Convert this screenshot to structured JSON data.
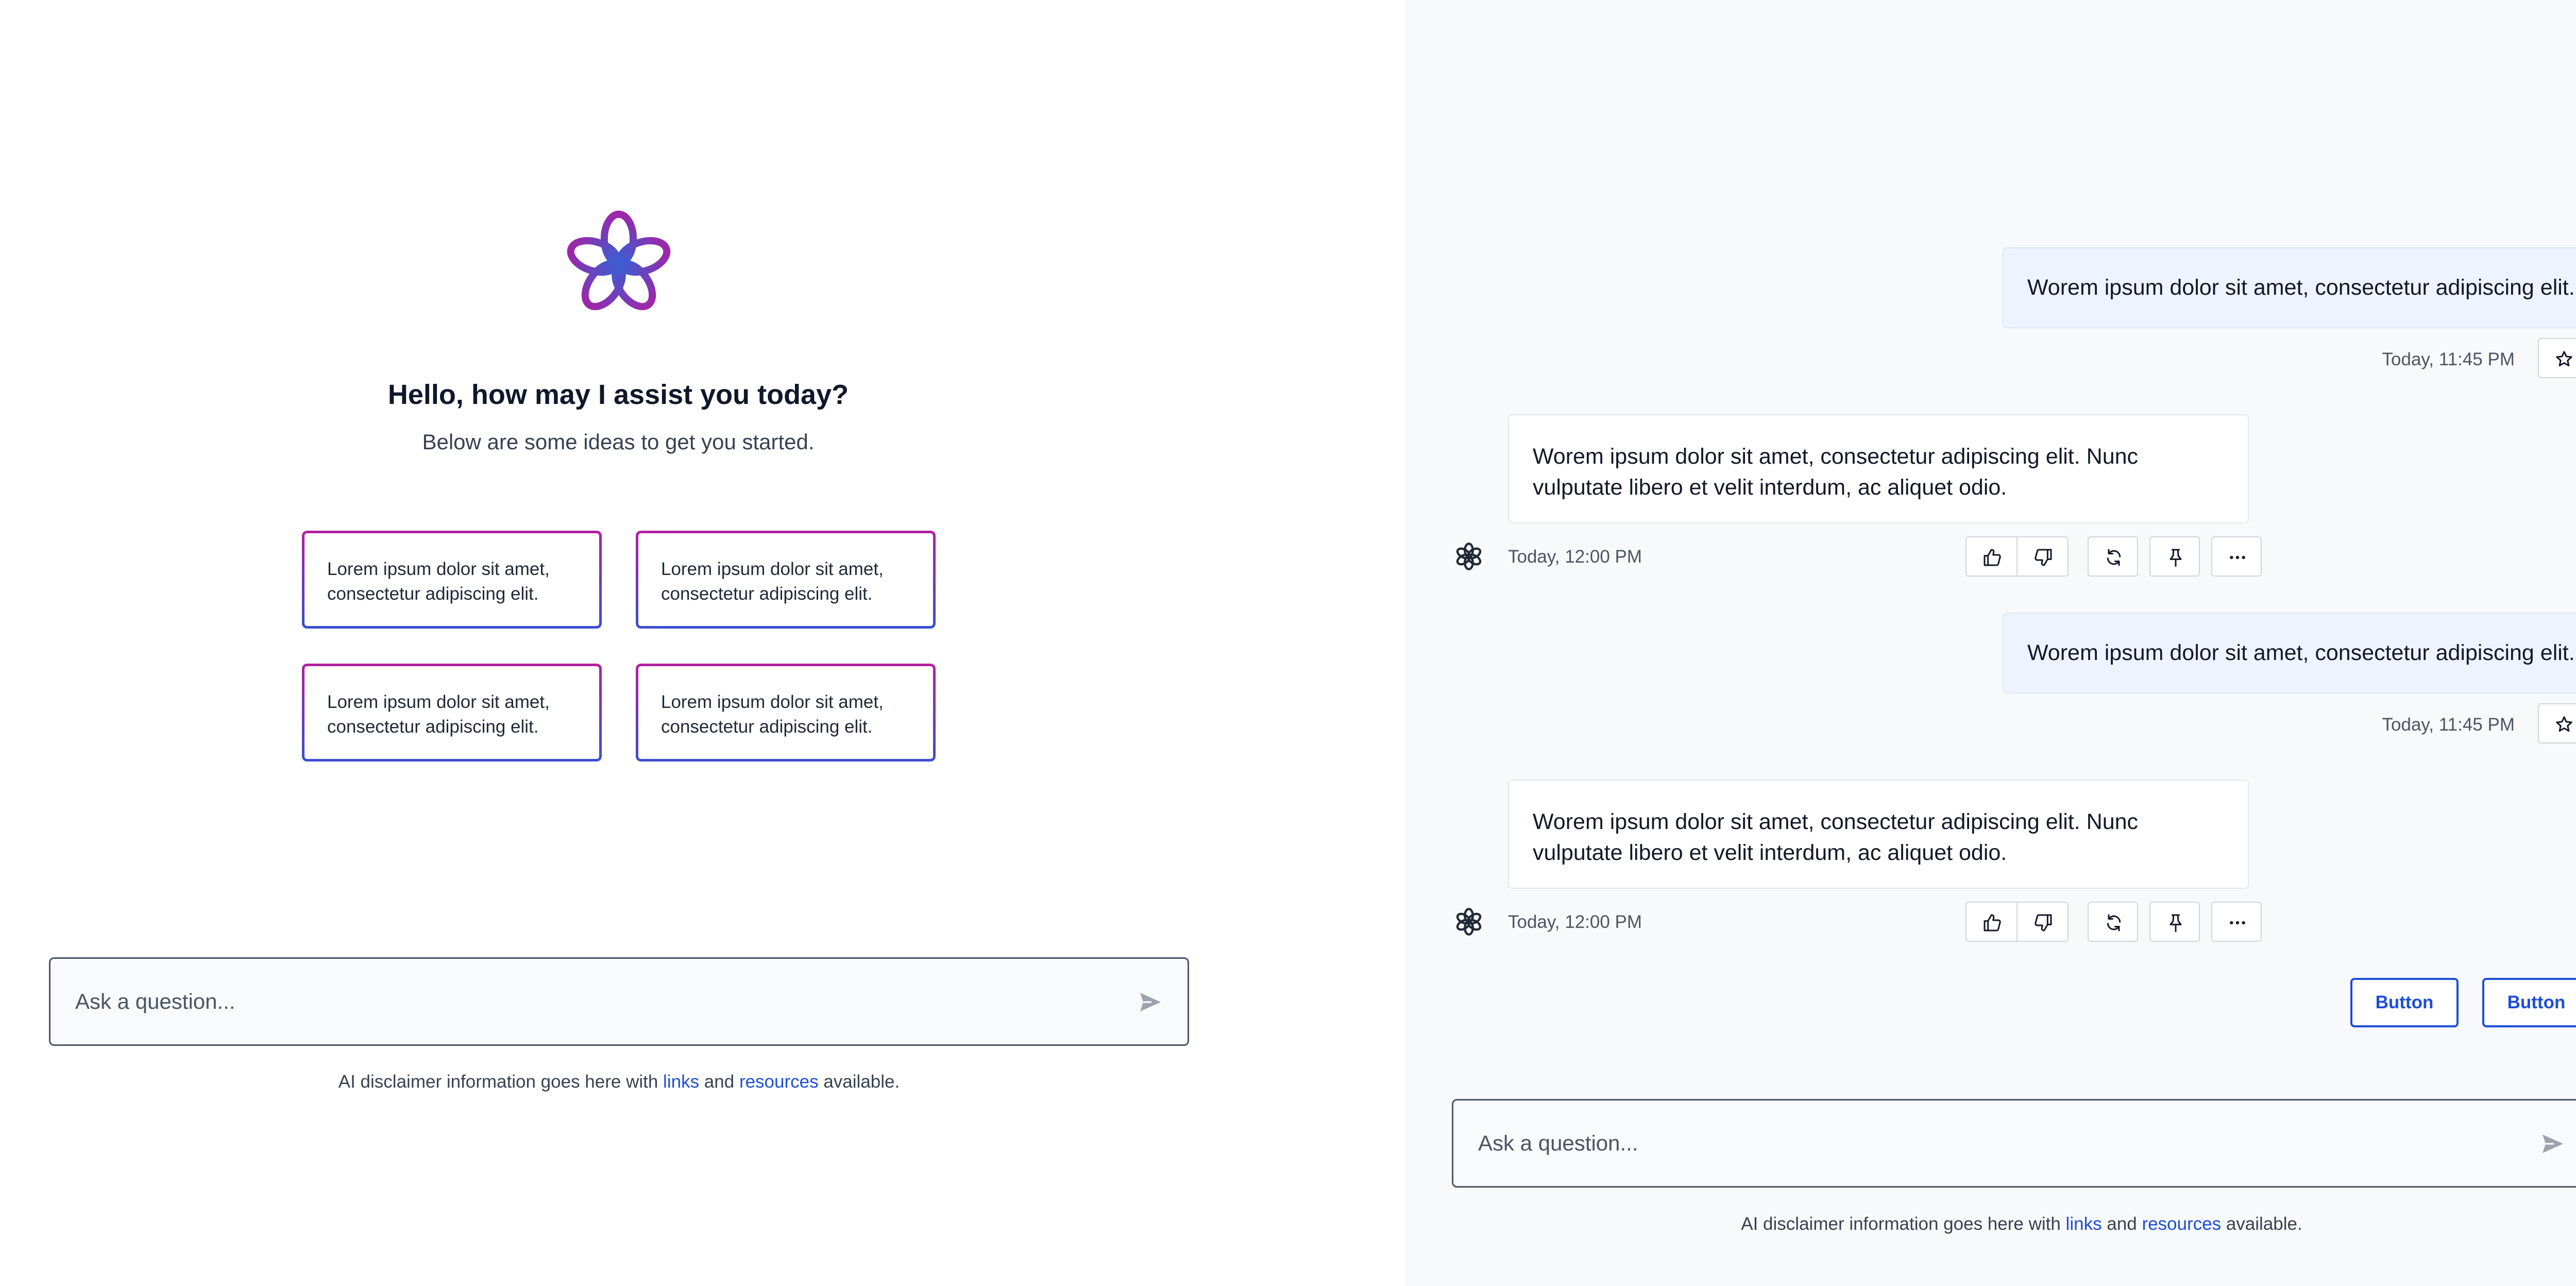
{
  "welcome": {
    "greeting": "Hello, how may I assist you today?",
    "subtitle": "Below are some ideas to get you started.",
    "ideas": [
      "Lorem ipsum dolor sit amet, consectetur adipiscing elit.",
      "Lorem ipsum dolor sit amet, consectetur adipiscing elit.",
      "Lorem ipsum dolor sit amet, consectetur adipiscing elit.",
      "Lorem ipsum dolor sit amet, consectetur adipiscing elit."
    ]
  },
  "composer": {
    "placeholder": "Ask a question..."
  },
  "disclaimer": {
    "prefix": "AI disclaimer information goes here with ",
    "link1": "links",
    "middle": " and ",
    "link2": "resources",
    "suffix": " available."
  },
  "conversation": {
    "messages": [
      {
        "role": "user",
        "text": "Worem ipsum dolor sit amet, consectetur adipiscing elit.",
        "time": "Today, 11:45 PM"
      },
      {
        "role": "assistant",
        "text": "Worem ipsum dolor sit amet, consectetur adipiscing elit. Nunc vulputate libero et velit interdum, ac aliquet odio.",
        "time": "Today, 12:00 PM"
      },
      {
        "role": "user",
        "text": "Worem ipsum dolor sit amet, consectetur adipiscing elit.",
        "time": "Today, 11:45 PM"
      },
      {
        "role": "assistant",
        "text": "Worem ipsum dolor sit amet, consectetur adipiscing elit. Nunc vulputate libero et velit interdum, ac aliquet odio.",
        "time": "Today, 12:00 PM"
      }
    ],
    "buttons": [
      "Button",
      "Button"
    ]
  },
  "icons": {
    "logo": "knot-flower-logo-icon",
    "send": "send-icon",
    "favorite": "star-icon",
    "thumbs_up": "thumbs-up-icon",
    "thumbs_down": "thumbs-down-icon",
    "regenerate": "regenerate-icon",
    "pin": "pin-icon",
    "more": "more-icon",
    "bot": "bot-avatar-icon"
  },
  "colors": {
    "accent": "#1d4ed8",
    "gradient_start": "#b21fa0",
    "gradient_end": "#3b4fcf",
    "user_bubble": "#eef4ff",
    "panel_bg": "#f8f9fb"
  }
}
